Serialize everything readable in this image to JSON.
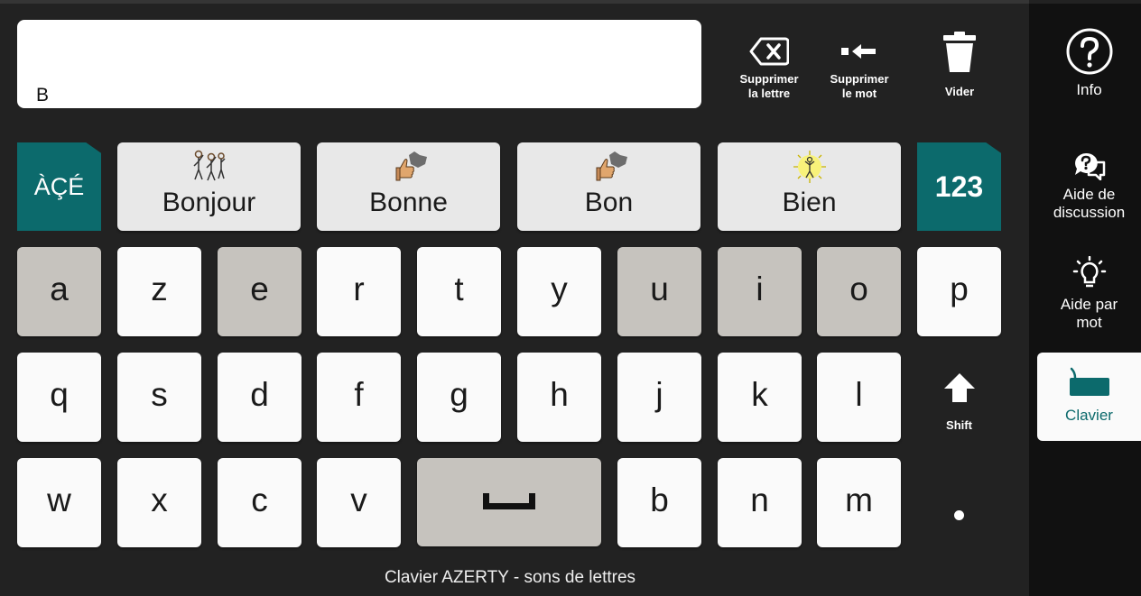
{
  "input": {
    "text": "B"
  },
  "actions": [
    {
      "label_line1": "Supprimer",
      "label_line2": "la lettre",
      "icon": "backspace-icon"
    },
    {
      "label_line1": "Supprimer",
      "label_line2": "le mot",
      "icon": "delete-word-icon"
    },
    {
      "label_line1": "Vider",
      "label_line2": "",
      "icon": "trash-icon"
    }
  ],
  "accent_key": "ÀÇÉ",
  "numbers_key": "123",
  "predictions": [
    {
      "label": "Bonjour",
      "icon": "greeting-people-icon"
    },
    {
      "label": "Bonne",
      "icon": "thumbs-up-icon"
    },
    {
      "label": "Bon",
      "icon": "thumbs-up-icon"
    },
    {
      "label": "Bien",
      "icon": "sun-person-icon"
    }
  ],
  "rows": {
    "row1": [
      "a",
      "z",
      "e",
      "r",
      "t",
      "y",
      "u",
      "i",
      "o",
      "p"
    ],
    "row2": [
      "q",
      "s",
      "d",
      "f",
      "g",
      "h",
      "j",
      "k",
      "l"
    ],
    "row3a": [
      "w",
      "x",
      "c",
      "v"
    ],
    "row3b": [
      "b",
      "n",
      "m"
    ]
  },
  "shift_label": "Shift",
  "caption": "Clavier AZERTY - sons de lettres",
  "sidebar": {
    "info": "Info",
    "discussion_line1": "Aide de",
    "discussion_line2": "discussion",
    "word_help_line1": "Aide par",
    "word_help_line2": "mot",
    "keyboard": "Clavier"
  },
  "colors": {
    "background": "#222222",
    "teal": "#0c6a6c",
    "vowel_key": "#c6c3be",
    "key": "#fafafa",
    "sidebar": "#111111"
  }
}
